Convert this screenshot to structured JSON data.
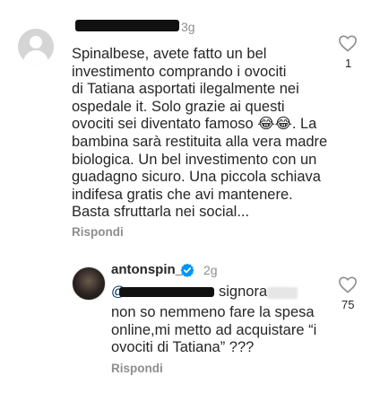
{
  "comment1": {
    "time": "3g",
    "text": "Spinalbese, avete fatto un bel investimento comprando i ovociti di Tatiana asportati ilegalmente nei ospedale it. Solo grazie ai questi ovociti sei diventato famoso 😂😂. La bambina sarà restituita alla vera madre biologica. Un bel investimento con un guadagno sicuro. Una piccola schiava indifesa gratis che avi mantenere. Basta sfruttarla nei social...",
    "lines": [
      "Spinalbese, avete fatto un bel",
      "investimento comprando i ovociti",
      "di Tatiana asportati ilegalmente nei",
      "ospedale it. Solo grazie ai questi",
      "ovociti sei diventato famoso 😂😂. La",
      "bambina sarà restituita alla vera madre",
      "biologica. Un bel investimento con un",
      "guadagno sicuro. Una piccola schiava",
      "indifesa gratis che avi mantenere.",
      "Basta sfruttarla nei social..."
    ],
    "reply_label": "Rispondi",
    "likes": "1"
  },
  "comment2": {
    "username": "antonspin_",
    "time": "2g",
    "mention_prefix": "@",
    "mention_suffix": "signora",
    "lines": [
      "non so nemmeno fare la spesa",
      "online,mi metto ad acquistare “i",
      "ovociti di Tatiana” ???"
    ],
    "reply_label": "Rispondi",
    "likes": "75"
  },
  "icons": {
    "like": "heart-outline-icon",
    "verified": "verified-badge-icon",
    "avatar": "default-avatar-icon"
  },
  "colors": {
    "text": "#262626",
    "secondary": "#8e8e8e",
    "verified": "#0095f6"
  }
}
